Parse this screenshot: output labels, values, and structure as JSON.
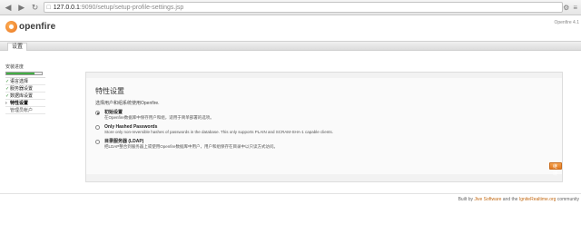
{
  "browser": {
    "url_host": "127.0.0.1",
    "url_path": ":9090/setup/setup-profile-settings.jsp"
  },
  "header": {
    "logo_text": "openfire",
    "version": "Openfire 4.1"
  },
  "tabs": [
    {
      "label": "设置"
    }
  ],
  "sidebar": {
    "title": "安装进度",
    "progress": 0.8,
    "steps": [
      {
        "label": "语言选择",
        "state": "done"
      },
      {
        "label": "服务器设置",
        "state": "done"
      },
      {
        "label": "数据库设置",
        "state": "done"
      },
      {
        "label": "特性设置",
        "state": "current"
      },
      {
        "label": "管理员帐户",
        "state": "pending"
      }
    ]
  },
  "main": {
    "title": "特性设置",
    "intro": "选择用户和组系统使用Openfire.",
    "options": [
      {
        "label": "初始设置",
        "desc": "在Openfire数据库中保存用户和组，适用于简单部署的选项。",
        "checked": true
      },
      {
        "label": "Only Hashed Passwords",
        "desc": "Store only non-reversible hashes of passwords in the database. This only supports PLAIN and SCRAM-SHA-1 capable clients.",
        "checked": false
      },
      {
        "label": "目录服务器 (LDAP)",
        "desc": "把LDAP整合到服务器上或使用Openfire数据库中用户，用户和组保存在目录中以只读方式访问。",
        "checked": false
      }
    ],
    "continue_label": "继续"
  },
  "footer": {
    "prefix": "Built by ",
    "link1": "Jive Software",
    "middle": " and the ",
    "link2": "IgniteRealtime.org",
    "suffix": " community"
  },
  "colors": {
    "accent": "#e0781f",
    "progress": "#2e9a31",
    "panel_bg": "#f2f2f2"
  }
}
